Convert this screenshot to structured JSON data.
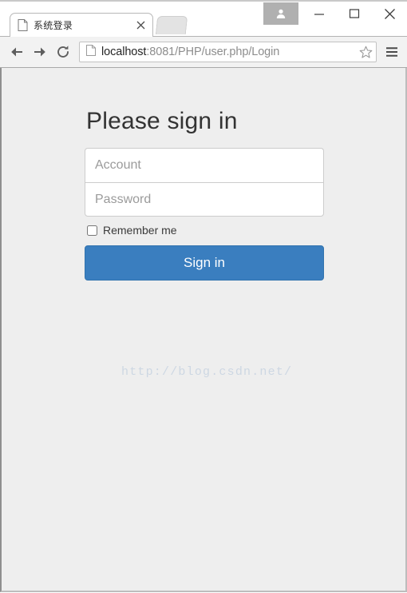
{
  "window": {
    "controls": {
      "user_icon": "user-avatar-icon",
      "minimize": "minimize-icon",
      "maximize": "maximize-icon",
      "close": "close-icon"
    }
  },
  "tab": {
    "title": "系统登录",
    "favicon": "page-document-icon",
    "close": "tab-close-icon",
    "new_tab": "new-tab-button"
  },
  "toolbar": {
    "back": "back-arrow-icon",
    "forward": "forward-arrow-icon",
    "reload": "reload-icon",
    "page_icon": "page-document-icon",
    "url_host": "localhost",
    "url_rest": ":8081/PHP/user.php/Login",
    "url_full": "localhost:8081/PHP/user.php/Login",
    "bookmark": "star-icon",
    "menu": "hamburger-menu-icon"
  },
  "page": {
    "heading": "Please sign in",
    "account": {
      "placeholder": "Account",
      "value": ""
    },
    "password": {
      "placeholder": "Password",
      "value": ""
    },
    "remember_label": "Remember me",
    "remember_checked": false,
    "submit_label": "Sign in",
    "watermark": "http://blog.csdn.net/",
    "background_color": "#eeeeee",
    "accent_color": "#3a7ebf"
  }
}
